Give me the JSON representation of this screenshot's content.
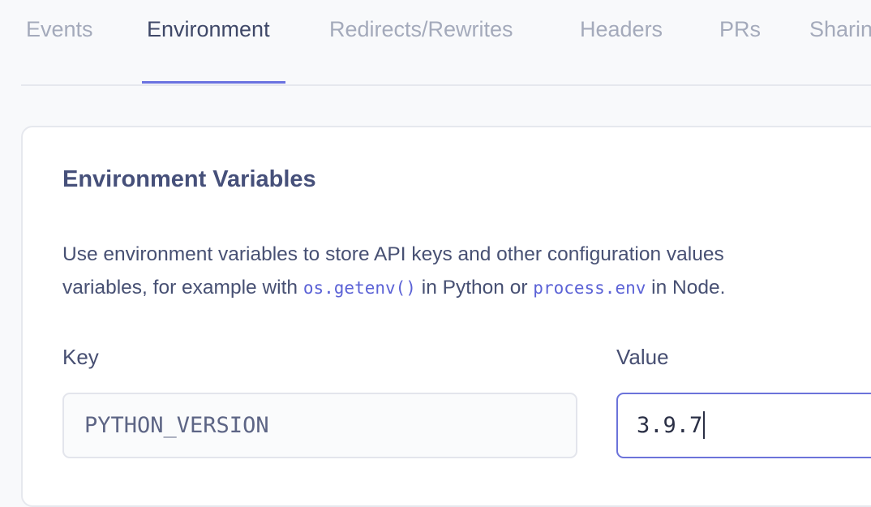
{
  "tabs": [
    {
      "label": "Events",
      "active": false
    },
    {
      "label": "Environment",
      "active": true
    },
    {
      "label": "Redirects/Rewrites",
      "active": false
    },
    {
      "label": "Headers",
      "active": false
    },
    {
      "label": "PRs",
      "active": false
    },
    {
      "label": "Sharin",
      "active": false
    }
  ],
  "card": {
    "title": "Environment Variables",
    "desc_line1": "Use environment variables to store API keys and other configuration values",
    "desc_line2_prefix": "variables, for example with ",
    "desc_code1": "os.getenv()",
    "desc_mid": " in Python or ",
    "desc_code2": "process.env",
    "desc_suffix": " in Node."
  },
  "form": {
    "key_label": "Key",
    "key_value": "PYTHON_VERSION",
    "value_label": "Value",
    "value_value": "3.9.7"
  },
  "colors": {
    "accent": "#6a72e0",
    "code": "#5b62d6"
  }
}
